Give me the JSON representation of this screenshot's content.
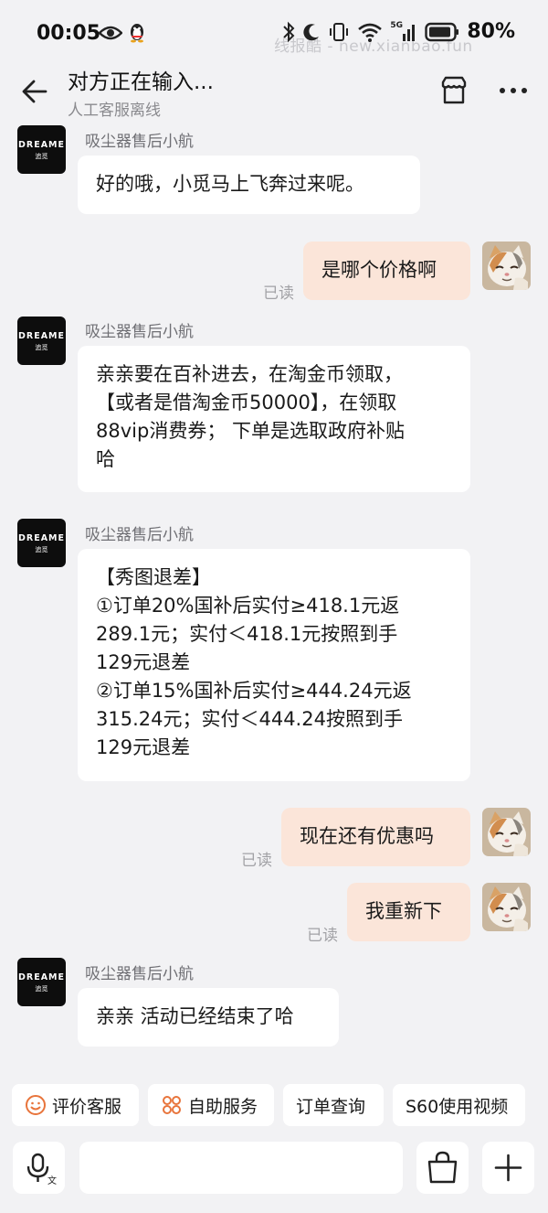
{
  "status_bar": {
    "time": "00:05",
    "watermark": "线报酷 - new.xianbao.fun",
    "signal_label": "5G",
    "battery": "80%"
  },
  "header": {
    "title": "对方正在输入...",
    "subtitle": "人工客服离线"
  },
  "brand_avatar": {
    "line1": "DREAME",
    "line2": "追觅"
  },
  "messages": [
    {
      "side": "in",
      "sender": "吸尘器售后小航",
      "lines": [
        "好的哦，小觅马上飞奔过来呢。"
      ]
    },
    {
      "side": "out",
      "read": "已读",
      "lines": [
        "是哪个价格啊"
      ]
    },
    {
      "side": "in",
      "sender": "吸尘器售后小航",
      "lines": [
        "亲亲要在百补进去，在淘金币领取，",
        "【或者是借淘金币50000】，在领取",
        "88vip消费券；  下单是选取政府补贴",
        "哈"
      ]
    },
    {
      "side": "in",
      "sender": "吸尘器售后小航",
      "lines": [
        "【秀图退差】",
        "①订单20%国补后实付≥418.1元返",
        "289.1元；实付＜418.1元按照到手",
        "129元退差",
        "②订单15%国补后实付≥444.24元返",
        "315.24元；实付＜444.24按照到手",
        "129元退差"
      ]
    },
    {
      "side": "out",
      "read": "已读",
      "lines": [
        "现在还有优惠吗"
      ]
    },
    {
      "side": "out",
      "read": "已读",
      "lines": [
        "我重新下"
      ]
    },
    {
      "side": "in",
      "sender": "吸尘器售后小航",
      "lines": [
        "亲亲 活动已经结束了哈"
      ]
    }
  ],
  "quick_replies": [
    {
      "label": "评价客服",
      "icon": "smile-icon"
    },
    {
      "label": "自助服务",
      "icon": "grid-flower-icon"
    },
    {
      "label": "订单查询",
      "icon": ""
    },
    {
      "label": "S60使用视频",
      "icon": ""
    }
  ],
  "colors": {
    "background": "#f2f2f4",
    "outgoing_bubble": "#fbe5d9",
    "incoming_bubble": "#ffffff",
    "accent_orange": "#e8743b"
  }
}
